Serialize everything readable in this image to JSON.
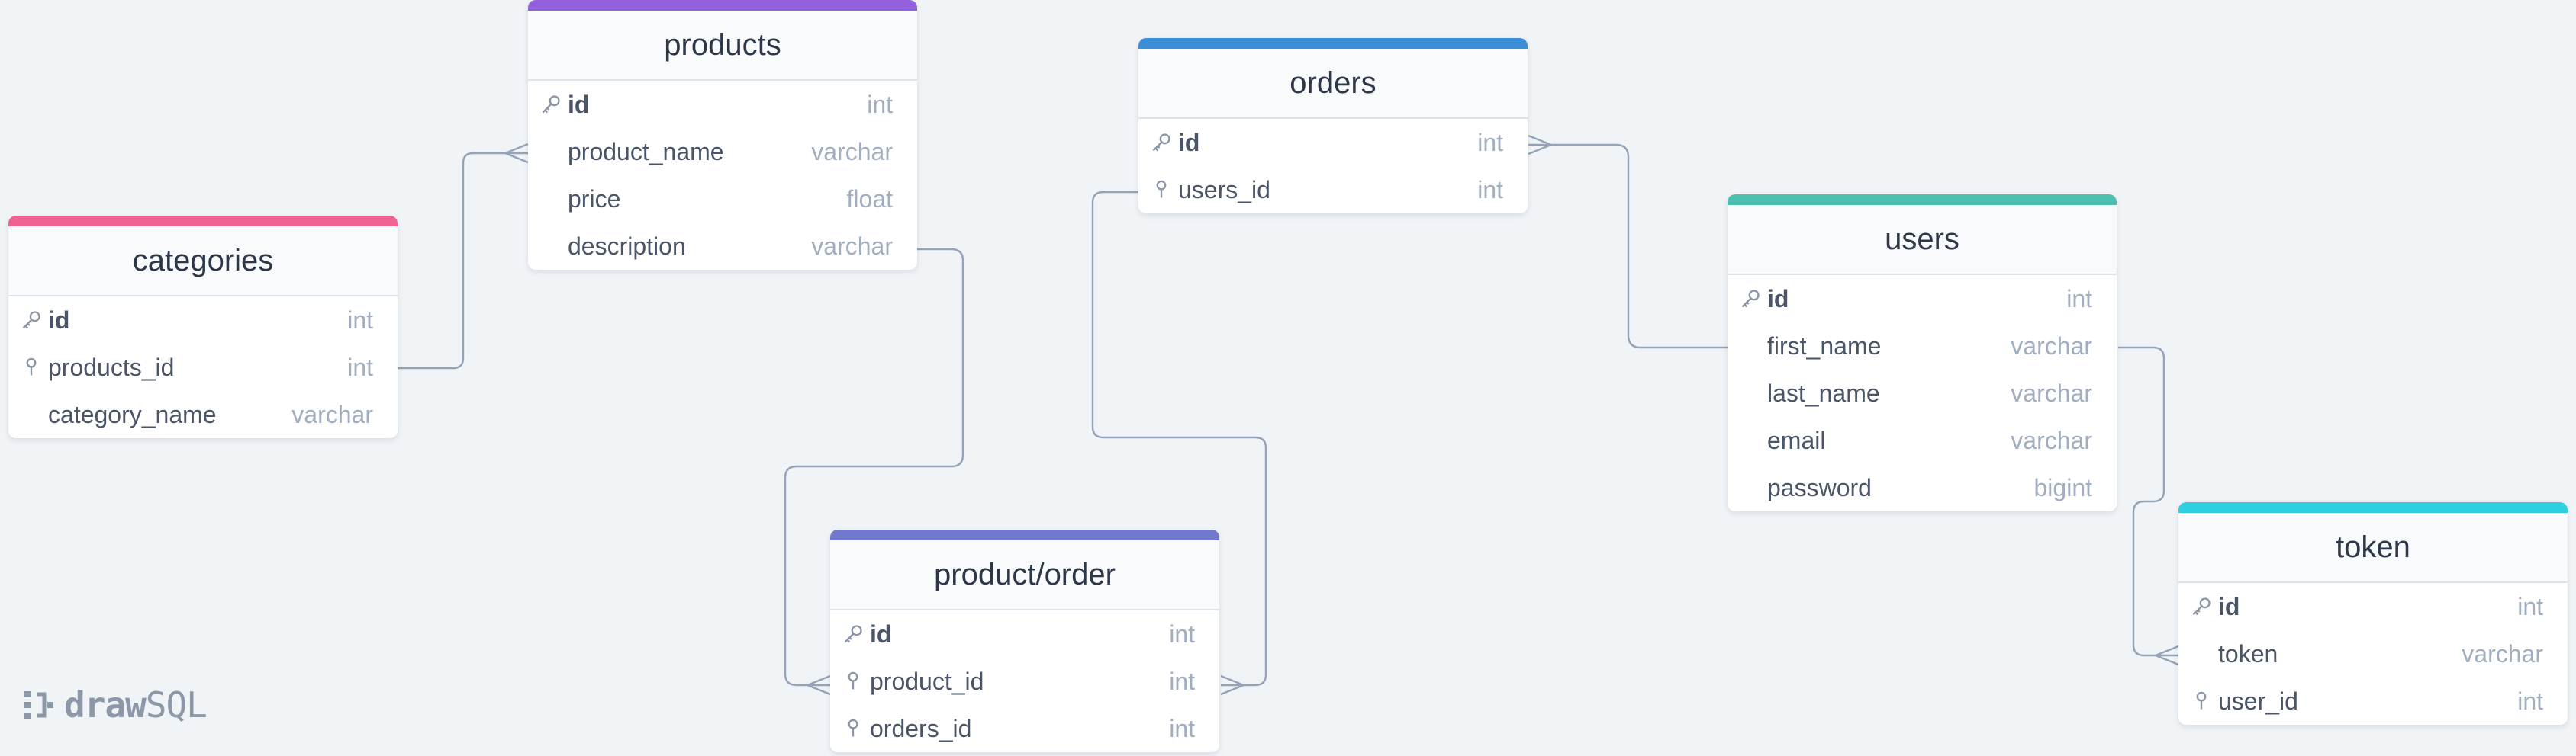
{
  "app": {
    "brand_bold": "draw",
    "brand_light": "SQL"
  },
  "colors": {
    "products": "#9360dd",
    "categories": "#f06292",
    "orders": "#3b8fd9",
    "product_order": "#7179cf",
    "users": "#4dbfae",
    "token": "#2dcfe0",
    "connector": "#94a3b8"
  },
  "tables": {
    "products": {
      "name": "products",
      "columns": [
        {
          "name": "id",
          "type": "int",
          "key": "primary"
        },
        {
          "name": "product_name",
          "type": "varchar",
          "key": "none"
        },
        {
          "name": "price",
          "type": "float",
          "key": "none"
        },
        {
          "name": "description",
          "type": "varchar",
          "key": "none"
        }
      ]
    },
    "categories": {
      "name": "categories",
      "columns": [
        {
          "name": "id",
          "type": "int",
          "key": "primary"
        },
        {
          "name": "products_id",
          "type": "int",
          "key": "foreign"
        },
        {
          "name": "category_name",
          "type": "varchar",
          "key": "none"
        }
      ]
    },
    "orders": {
      "name": "orders",
      "columns": [
        {
          "name": "id",
          "type": "int",
          "key": "primary"
        },
        {
          "name": "users_id",
          "type": "int",
          "key": "foreign"
        }
      ]
    },
    "product_order": {
      "name": "product/order",
      "columns": [
        {
          "name": "id",
          "type": "int",
          "key": "primary"
        },
        {
          "name": "product_id",
          "type": "int",
          "key": "foreign"
        },
        {
          "name": "orders_id",
          "type": "int",
          "key": "foreign"
        }
      ]
    },
    "users": {
      "name": "users",
      "columns": [
        {
          "name": "id",
          "type": "int",
          "key": "primary"
        },
        {
          "name": "first_name",
          "type": "varchar",
          "key": "none"
        },
        {
          "name": "last_name",
          "type": "varchar",
          "key": "none"
        },
        {
          "name": "email",
          "type": "varchar",
          "key": "none"
        },
        {
          "name": "password",
          "type": "bigint",
          "key": "none"
        }
      ]
    },
    "token": {
      "name": "token",
      "columns": [
        {
          "name": "id",
          "type": "int",
          "key": "primary"
        },
        {
          "name": "token",
          "type": "varchar",
          "key": "none"
        },
        {
          "name": "user_id",
          "type": "int",
          "key": "foreign"
        }
      ]
    }
  },
  "relationships": [
    {
      "from": "categories.products_id",
      "to": "products.id",
      "to_cardinality": "many"
    },
    {
      "from": "products.description",
      "to": "product_order.product_id",
      "to_cardinality": "many"
    },
    {
      "from": "orders.users_id",
      "to": "product_order.orders_id",
      "to_cardinality": "many"
    },
    {
      "from": "users.first_name",
      "to": "orders.id",
      "to_cardinality": "many"
    },
    {
      "from": "users.first_name",
      "to": "token.token",
      "to_cardinality": "many"
    }
  ]
}
